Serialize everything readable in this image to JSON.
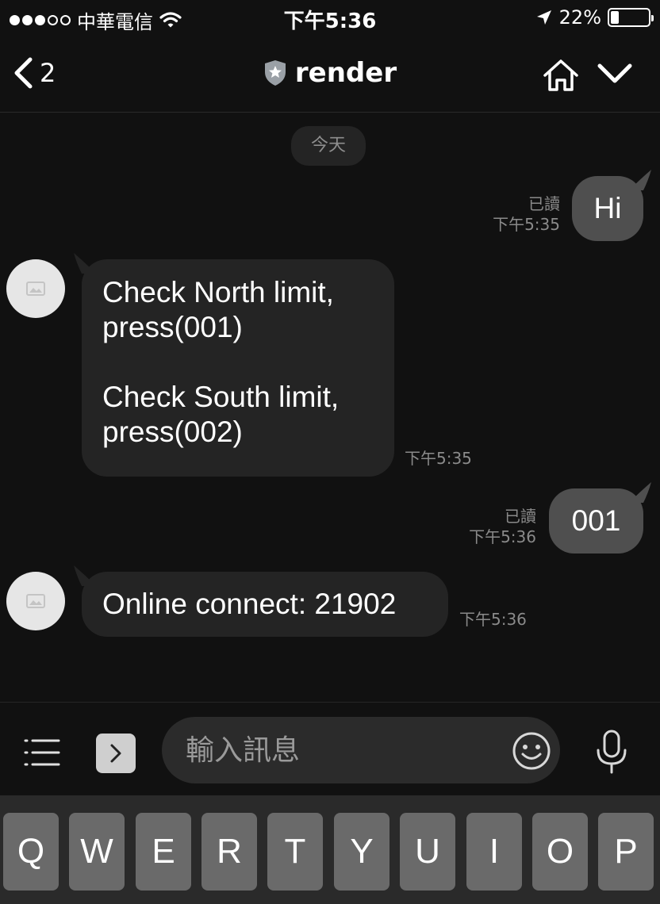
{
  "status_bar": {
    "carrier": "中華電信",
    "time": "下午5:36",
    "battery": "22%",
    "battery_level": 0.22,
    "icons": [
      "signal-dots",
      "wifi-icon",
      "location-arrow-icon",
      "battery-icon"
    ]
  },
  "nav": {
    "back_count": "2",
    "title": "render",
    "icons": [
      "back-chevron-icon",
      "shield-star-icon",
      "home-icon",
      "chevron-down-icon"
    ]
  },
  "chat": {
    "date_label": "今天",
    "messages": [
      {
        "direction": "out",
        "text": "Hi",
        "read": "已讀",
        "time": "下午5:35"
      },
      {
        "direction": "in",
        "lines": [
          "Check North limit,",
          "press(001)",
          "",
          "Check South limit,",
          "press(002)"
        ],
        "time": "下午5:35"
      },
      {
        "direction": "out",
        "text": "001",
        "read": "已讀",
        "time": "下午5:36"
      },
      {
        "direction": "in",
        "text": "Online connect: 21902",
        "time": "下午5:36"
      }
    ]
  },
  "input_bar": {
    "placeholder": "輸入訊息",
    "icons": [
      "menu-icon",
      "expand-chevron-icon",
      "emoji-icon",
      "microphone-icon"
    ]
  },
  "keyboard": {
    "keys": [
      "Q",
      "W",
      "E",
      "R",
      "T",
      "Y",
      "U",
      "I",
      "O",
      "P"
    ]
  },
  "colors": {
    "background": "#111111",
    "incoming_bubble": "#242424",
    "outgoing_bubble": "#4f4f4f",
    "meta_text": "#8a8a8a",
    "key": "#6a6a6a"
  }
}
